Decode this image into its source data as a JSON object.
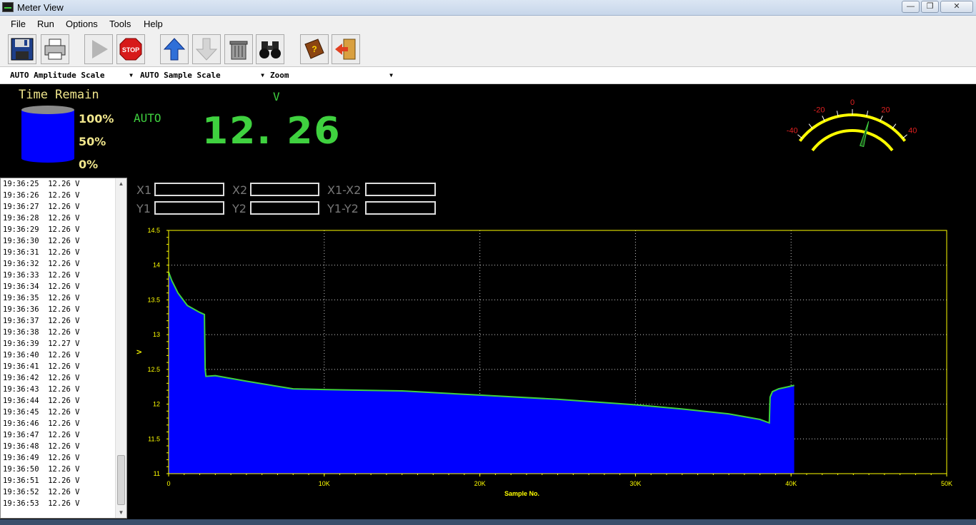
{
  "window": {
    "title": "Meter View",
    "minimize": "—",
    "maximize": "❐",
    "close": "✕"
  },
  "menu": [
    "File",
    "Run",
    "Options",
    "Tools",
    "Help"
  ],
  "toolbar": {
    "stop_label": "STOP",
    "icons": [
      "save-icon",
      "print-icon",
      "play-icon",
      "stop-icon",
      "up-arrow-icon",
      "down-arrow-icon",
      "trash-icon",
      "binoculars-icon",
      "help-book-icon",
      "exit-icon"
    ]
  },
  "combos": {
    "amplitude": "AUTO Amplitude Scale",
    "sample": "AUTO Sample Scale",
    "zoom": "Zoom"
  },
  "meter": {
    "time_remain_label": "Time Remain",
    "pct_100": "100%",
    "pct_50": "50%",
    "pct_0": "0%",
    "auto": "AUTO",
    "unit": "V",
    "reading": "12. 26"
  },
  "gauge": {
    "labels": [
      "-40",
      "-20",
      "0",
      "20",
      "40"
    ],
    "needle_value": 12.26
  },
  "log": [
    "19:36:25  12.26 V",
    "19:36:26  12.26 V",
    "19:36:27  12.26 V",
    "19:36:28  12.26 V",
    "19:36:29  12.26 V",
    "19:36:30  12.26 V",
    "19:36:31  12.26 V",
    "19:36:32  12.26 V",
    "19:36:33  12.26 V",
    "19:36:34  12.26 V",
    "19:36:35  12.26 V",
    "19:36:36  12.26 V",
    "19:36:37  12.26 V",
    "19:36:38  12.26 V",
    "19:36:39  12.27 V",
    "19:36:40  12.26 V",
    "19:36:41  12.26 V",
    "19:36:42  12.26 V",
    "19:36:43  12.26 V",
    "19:36:44  12.26 V",
    "19:36:45  12.26 V",
    "19:36:46  12.26 V",
    "19:36:47  12.26 V",
    "19:36:48  12.26 V",
    "19:36:49  12.26 V",
    "19:36:50  12.26 V",
    "19:36:51  12.26 V",
    "19:36:52  12.26 V",
    "19:36:53  12.26 V"
  ],
  "cursors": {
    "x1": "X1",
    "x2": "X2",
    "x1x2": "X1-X2",
    "y1": "Y1",
    "y2": "Y2",
    "y1y2": "Y1-Y2"
  },
  "chart_data": {
    "type": "area",
    "xlabel": "Sample No.",
    "ylabel": "V",
    "xlim": [
      0,
      50000
    ],
    "ylim": [
      11,
      14.5
    ],
    "xticks": [
      0,
      10000,
      20000,
      30000,
      40000,
      50000
    ],
    "xtick_labels": [
      "0",
      "10K",
      "20K",
      "30K",
      "40K",
      "50K"
    ],
    "yticks": [
      11,
      11.5,
      12,
      12.5,
      13,
      13.5,
      14,
      14.5
    ],
    "ytick_labels": [
      "11",
      "11.5",
      "12",
      "12.5",
      "13",
      "13.5",
      "14",
      "14.5"
    ],
    "grid": true,
    "fill_color": "#0000ff",
    "line_color": "#3fd13f",
    "series": [
      {
        "x": [
          0,
          200,
          600,
          1200,
          2000,
          2300,
          2350,
          2400,
          3000,
          5000,
          8000,
          10000,
          15000,
          20000,
          25000,
          30000,
          33000,
          36000,
          38000,
          38600,
          38650,
          38800,
          39200,
          39800,
          40200
        ],
        "values": [
          13.9,
          13.78,
          13.6,
          13.42,
          13.32,
          13.29,
          12.5,
          12.4,
          12.41,
          12.33,
          12.22,
          12.21,
          12.19,
          12.13,
          12.07,
          11.99,
          11.93,
          11.86,
          11.78,
          11.73,
          12.1,
          12.18,
          12.22,
          12.25,
          12.27
        ]
      }
    ]
  }
}
